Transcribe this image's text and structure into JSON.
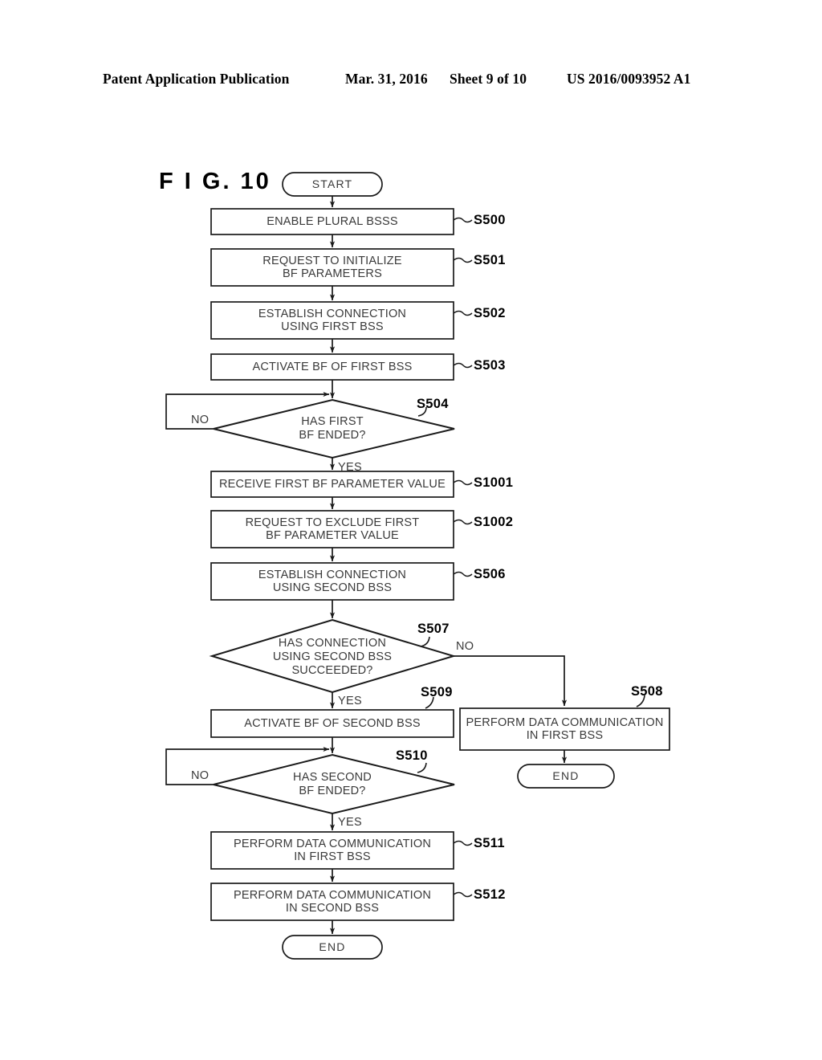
{
  "header": {
    "publication": "Patent Application Publication",
    "date": "Mar. 31, 2016",
    "sheet": "Sheet 9 of 10",
    "docnum": "US 2016/0093952 A1"
  },
  "figure": {
    "title": "F I G.  10"
  },
  "flowchart": {
    "terminators": {
      "start": "START",
      "end_right": "END",
      "end_bottom": "END"
    },
    "branches": {
      "s504_no": "NO",
      "s504_yes": "YES",
      "s507_no": "NO",
      "s507_yes": "YES",
      "s510_no": "NO",
      "s510_yes": "YES"
    },
    "nodes": [
      {
        "id": "S500",
        "shape": "process",
        "text": "ENABLE PLURAL BSSS"
      },
      {
        "id": "S501",
        "shape": "process",
        "text": "REQUEST TO INITIALIZE\nBF PARAMETERS"
      },
      {
        "id": "S502",
        "shape": "process",
        "text": "ESTABLISH CONNECTION\nUSING FIRST BSS"
      },
      {
        "id": "S503",
        "shape": "process",
        "text": "ACTIVATE BF OF FIRST BSS"
      },
      {
        "id": "S504",
        "shape": "decision",
        "text": "HAS FIRST\nBF ENDED?"
      },
      {
        "id": "S1001",
        "shape": "process",
        "text": "RECEIVE FIRST BF PARAMETER VALUE"
      },
      {
        "id": "S1002",
        "shape": "process",
        "text": "REQUEST TO EXCLUDE FIRST\nBF PARAMETER VALUE"
      },
      {
        "id": "S506",
        "shape": "process",
        "text": "ESTABLISH CONNECTION\nUSING SECOND BSS"
      },
      {
        "id": "S507",
        "shape": "decision",
        "text": "HAS CONNECTION\nUSING SECOND BSS\nSUCCEEDED?"
      },
      {
        "id": "S509",
        "shape": "process",
        "text": "ACTIVATE BF OF SECOND BSS"
      },
      {
        "id": "S508",
        "shape": "process",
        "text": "PERFORM DATA COMMUNICATION\nIN FIRST BSS"
      },
      {
        "id": "S510",
        "shape": "decision",
        "text": "HAS SECOND\nBF ENDED?"
      },
      {
        "id": "S511",
        "shape": "process",
        "text": "PERFORM DATA COMMUNICATION\nIN FIRST BSS"
      },
      {
        "id": "S512",
        "shape": "process",
        "text": "PERFORM DATA COMMUNICATION\nIN SECOND BSS"
      }
    ]
  },
  "colors": {
    "line": "#1a1a1a",
    "text": "#3a3a3a",
    "background": "#ffffff"
  }
}
